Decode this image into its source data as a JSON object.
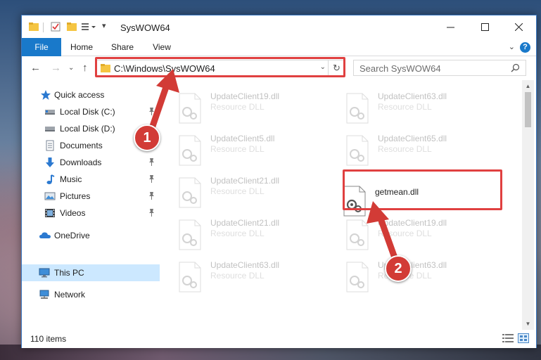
{
  "window": {
    "title": "SysWOW64"
  },
  "ribbon": {
    "tabs": [
      "File",
      "Home",
      "Share",
      "View"
    ],
    "help": "?"
  },
  "navigation": {
    "address": "C:\\Windows\\SysWOW64",
    "search_placeholder": "Search SysWOW64"
  },
  "sidebar": {
    "items": [
      {
        "label": "Quick access",
        "icon": "star-icon"
      },
      {
        "label": "Local Disk (C:)",
        "icon": "drive-icon",
        "pinned": true
      },
      {
        "label": "Local Disk (D:)",
        "icon": "drive-icon",
        "pinned": false
      },
      {
        "label": "Documents",
        "icon": "documents-icon",
        "pinned": true
      },
      {
        "label": "Downloads",
        "icon": "download-icon",
        "pinned": true
      },
      {
        "label": "Music",
        "icon": "music-icon",
        "pinned": true
      },
      {
        "label": "Pictures",
        "icon": "pictures-icon",
        "pinned": true
      },
      {
        "label": "Videos",
        "icon": "videos-icon",
        "pinned": true
      },
      {
        "label": "OneDrive",
        "icon": "cloud-icon"
      },
      {
        "label": "This PC",
        "icon": "computer-icon",
        "selected": true
      },
      {
        "label": "Network",
        "icon": "network-icon"
      }
    ]
  },
  "files": [
    {
      "name": "UpdateClient19.dll",
      "type": "Resource DLL",
      "faded": true
    },
    {
      "name": "UpdateClient63.dll",
      "type": "Resource DLL",
      "faded": true
    },
    {
      "name": "UpdateClient5.dll",
      "type": "Resource DLL",
      "faded": true
    },
    {
      "name": "UpdateClient65.dll",
      "type": "Resource DLL",
      "faded": true
    },
    {
      "name": "UpdateClient21.dll",
      "type": "Resource DLL",
      "faded": true
    },
    {
      "name": "getmean.dll",
      "type": "",
      "faded": false
    },
    {
      "name": "UpdateClient21.dll",
      "type": "Resource DLL",
      "faded": true
    },
    {
      "name": "UpdateClient19.dll",
      "type": "Resource DLL",
      "faded": true
    },
    {
      "name": "UpdateClient63.dll",
      "type": "Resource DLL",
      "faded": true
    },
    {
      "name": "UpdateClient63.dll",
      "type": "Resource DLL",
      "faded": true
    }
  ],
  "status": {
    "item_count": "110 items"
  },
  "annotations": {
    "badge_1": "1",
    "badge_2": "2",
    "color": "#e04040"
  },
  "colors": {
    "accent": "#1979ca",
    "selected": "#cce8ff"
  }
}
